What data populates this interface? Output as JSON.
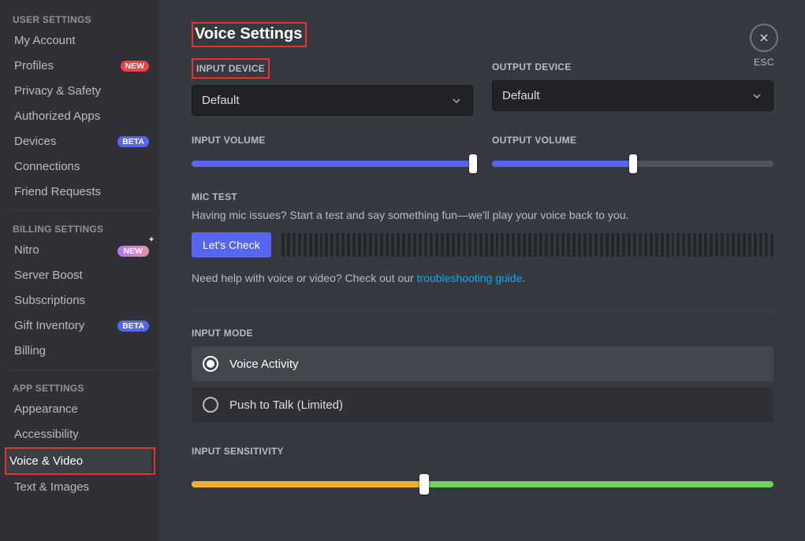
{
  "sidebar": {
    "headers": {
      "user": "USER SETTINGS",
      "billing": "BILLING SETTINGS",
      "app": "APP SETTINGS"
    },
    "items": {
      "account": "My Account",
      "profiles": "Profiles",
      "privacy": "Privacy & Safety",
      "apps": "Authorized Apps",
      "devices": "Devices",
      "connections": "Connections",
      "friend_requests": "Friend Requests",
      "nitro": "Nitro",
      "server_boost": "Server Boost",
      "subscriptions": "Subscriptions",
      "gift_inventory": "Gift Inventory",
      "billing": "Billing",
      "appearance": "Appearance",
      "accessibility": "Accessibility",
      "voice_video": "Voice & Video",
      "text_images": "Text & Images"
    },
    "badges": {
      "new": "NEW",
      "beta": "BETA"
    }
  },
  "main": {
    "title": "Voice Settings",
    "input_device_label": "INPUT DEVICE",
    "output_device_label": "OUTPUT DEVICE",
    "input_device_value": "Default",
    "output_device_value": "Default",
    "input_volume_label": "INPUT VOLUME",
    "output_volume_label": "OUTPUT VOLUME",
    "input_volume_percent": 100,
    "output_volume_percent": 50,
    "mic_test_label": "MIC TEST",
    "mic_test_desc": "Having mic issues? Start a test and say something fun—we'll play your voice back to you.",
    "lets_check": "Let's Check",
    "help_text_pre": "Need help with voice or video? Check out our ",
    "help_link": "troubleshooting guide",
    "help_text_post": ".",
    "input_mode_label": "INPUT MODE",
    "voice_activity": "Voice Activity",
    "push_to_talk": "Push to Talk (Limited)",
    "input_sensitivity_label": "INPUT SENSITIVITY",
    "sensitivity_percent": 40
  },
  "close": {
    "label": "ESC"
  }
}
